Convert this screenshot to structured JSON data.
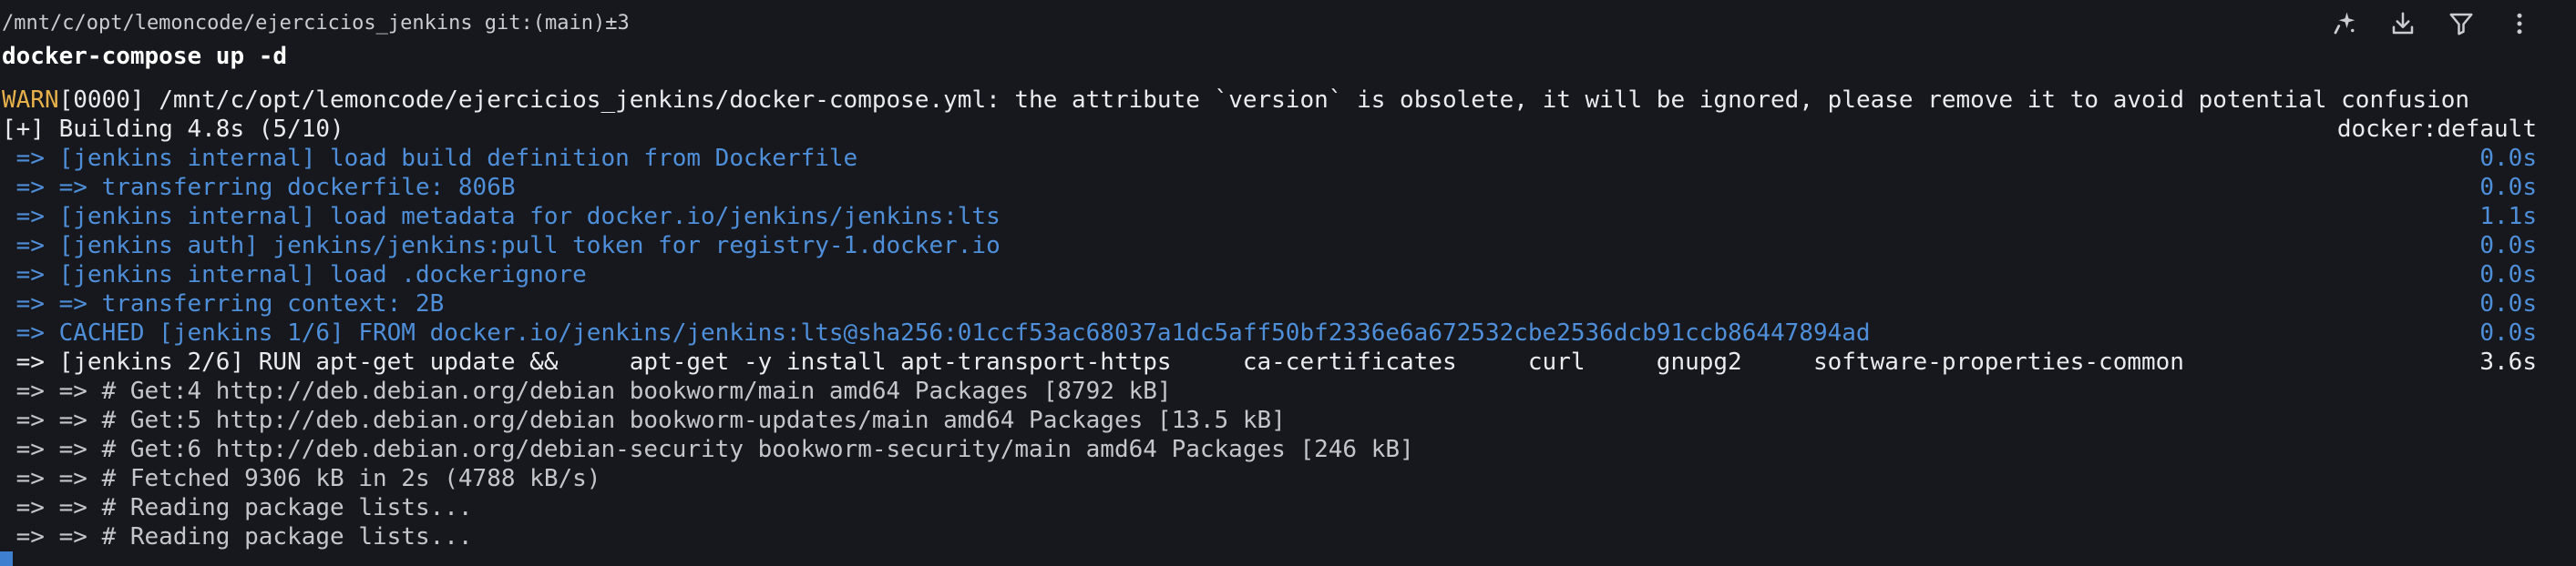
{
  "prompt": {
    "path": "/mnt/c/opt/lemoncode/ejercicios_jenkins git:(main)±3",
    "command": "docker-compose up -d"
  },
  "toolbar": {
    "icons": [
      "sparkle-icon",
      "download-icon",
      "filter-icon",
      "more-vertical-icon"
    ]
  },
  "output": {
    "warn_tag": "WARN",
    "warn_text": "[0000] /mnt/c/opt/lemoncode/ejercicios_jenkins/docker-compose.yml: the attribute `version` is obsolete, it will be ignored, please remove it to avoid potential confusion",
    "building": "[+] Building 4.8s (5/10)",
    "context": "docker:default",
    "steps": [
      {
        "text": " => [jenkins internal] load build definition from Dockerfile",
        "time": "0.0s"
      },
      {
        "text": " => => transferring dockerfile: 806B",
        "time": "0.0s"
      },
      {
        "text": " => [jenkins internal] load metadata for docker.io/jenkins/jenkins:lts",
        "time": "1.1s"
      },
      {
        "text": " => [jenkins auth] jenkins/jenkins:pull token for registry-1.docker.io",
        "time": "0.0s"
      },
      {
        "text": " => [jenkins internal] load .dockerignore",
        "time": "0.0s"
      },
      {
        "text": " => => transferring context: 2B",
        "time": "0.0s"
      },
      {
        "text": " => CACHED [jenkins 1/6] FROM docker.io/jenkins/jenkins:lts@sha256:01ccf53ac68037a1dc5aff50bf2336e6a672532cbe2536dcb91ccb86447894ad",
        "time": "0.0s"
      }
    ],
    "running": {
      "text": " => [jenkins 2/6] RUN apt-get update &&     apt-get -y install apt-transport-https     ca-certificates     curl     gnupg2     software-properties-common",
      "time": "3.6s"
    },
    "logs": [
      " => => # Get:4 http://deb.debian.org/debian bookworm/main amd64 Packages [8792 kB]",
      " => => # Get:5 http://deb.debian.org/debian bookworm-updates/main amd64 Packages [13.5 kB]",
      " => => # Get:6 http://deb.debian.org/debian-security bookworm-security/main amd64 Packages [246 kB]",
      " => => # Fetched 9306 kB in 2s (4788 kB/s)",
      " => => # Reading package lists...",
      " => => # Reading package lists..."
    ]
  },
  "colors": {
    "background": "#16181d",
    "warn": "#e6b04a",
    "step_blue": "#4f8fd9",
    "log_gray": "#c3c6cb",
    "cursor": "#3f7fd0"
  }
}
